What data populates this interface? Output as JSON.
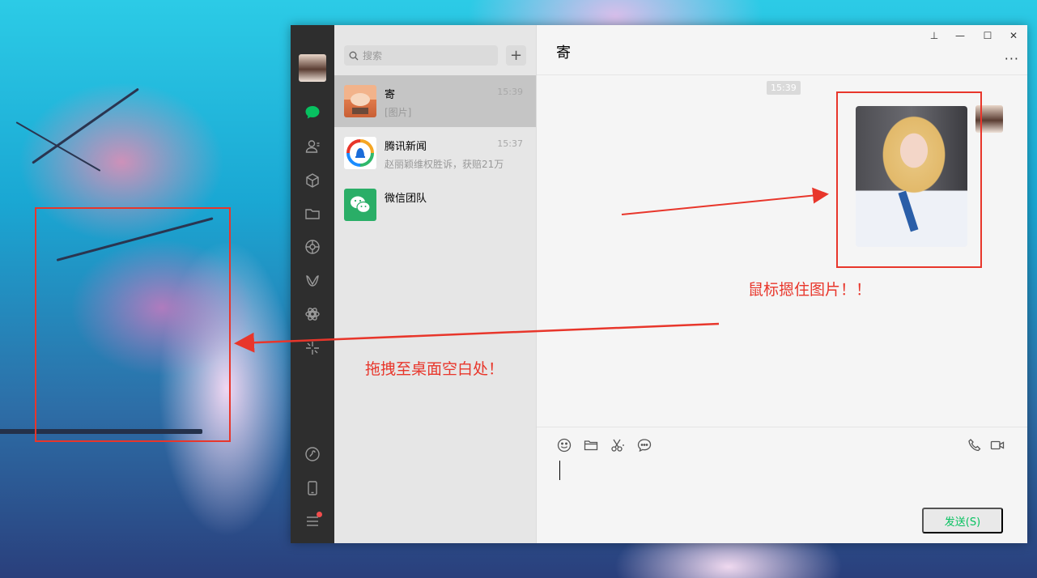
{
  "sidebar": {
    "icons": [
      "avatar",
      "chat-icon",
      "contacts-icon",
      "favorites-icon",
      "folder-icon",
      "moments-icon",
      "channels-icon",
      "mini-programs-icon",
      "search-feature-icon",
      "miniapp-link-icon",
      "phone-icon",
      "menu-icon"
    ],
    "accent": "#07c160"
  },
  "list": {
    "search_placeholder": "搜索",
    "add_label": "+",
    "conversations": [
      {
        "name": "寄",
        "time": "15:39",
        "preview": "[图片]"
      },
      {
        "name": "腾讯新闻",
        "time": "15:37",
        "preview": "赵丽颖维权胜诉，获赔21万"
      },
      {
        "name": "微信团队",
        "time": "",
        "preview": ""
      }
    ]
  },
  "chat": {
    "title": "寄",
    "more": "···",
    "time": "15:39",
    "send_label": "发送(S)"
  },
  "window_controls": {
    "pin": "⊥",
    "minimize": "—",
    "maximize": "☐",
    "close": "✕"
  },
  "annotations": {
    "hold_text": "鼠标摁住图片！！",
    "drag_text": "拖拽至桌面空白处！",
    "color": "#e8362b"
  }
}
